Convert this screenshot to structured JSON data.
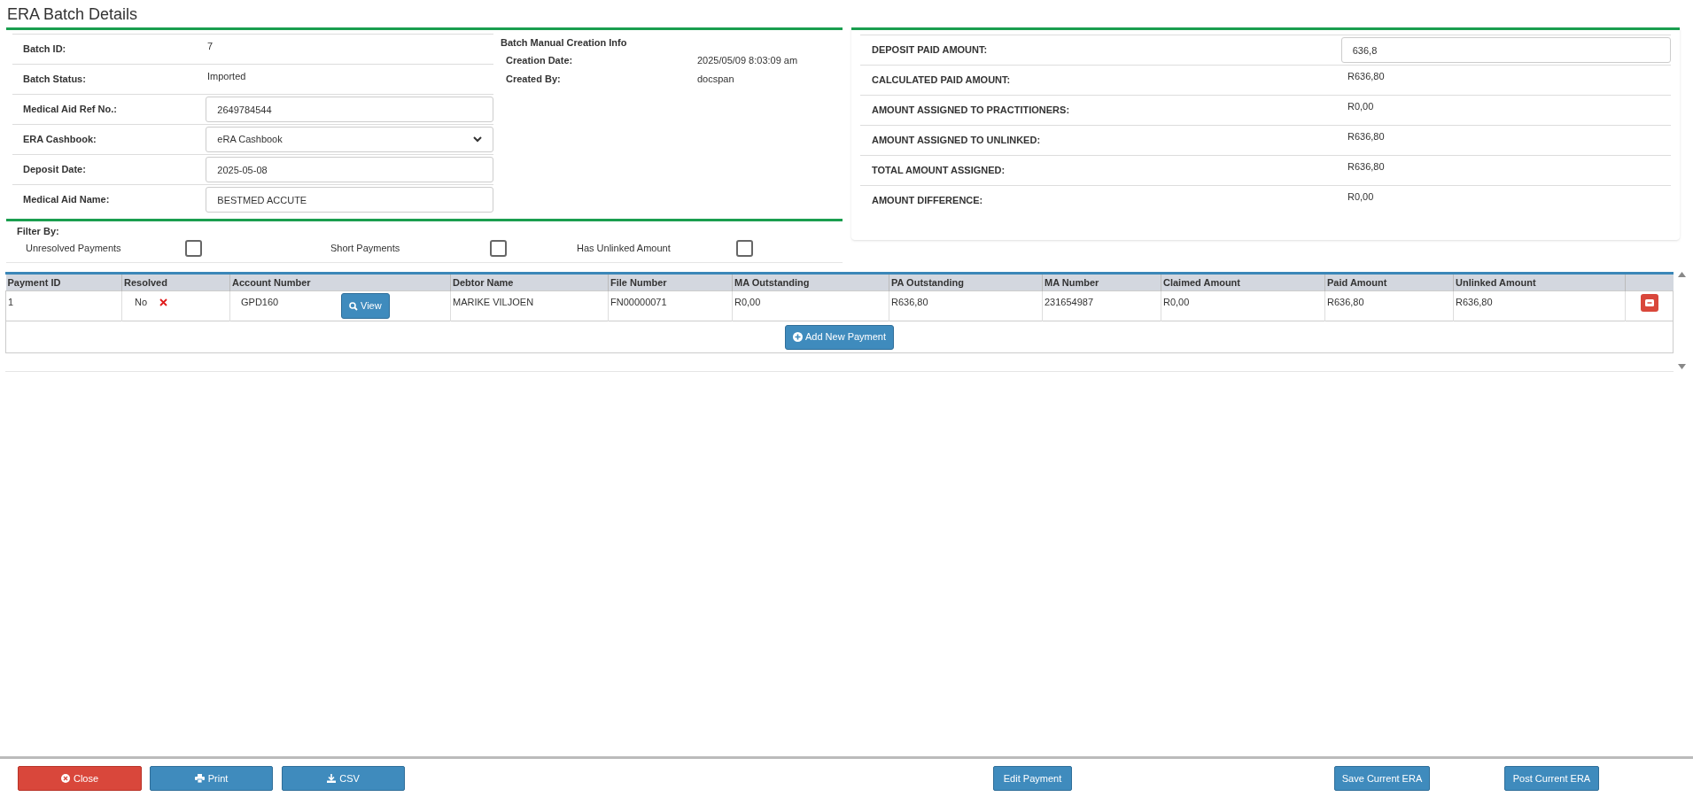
{
  "title": "ERA Batch Details",
  "batch_fields": [
    {
      "label": "Batch ID:",
      "kind": "text",
      "value": "7"
    },
    {
      "label": "Batch Status:",
      "kind": "text",
      "value": "Imported"
    },
    {
      "label": "Medical Aid Ref No.:",
      "kind": "input",
      "value": "2649784544"
    },
    {
      "label": "ERA Cashbook:",
      "kind": "select",
      "value": "eRA Cashbook"
    },
    {
      "label": "Deposit Date:",
      "kind": "input",
      "value": "2025-05-08"
    },
    {
      "label": "Medical Aid Name:",
      "kind": "input",
      "value": "BESTMED ACCUTE"
    }
  ],
  "creation_info": {
    "heading": "Batch Manual Creation Info",
    "rows": [
      {
        "label": "Creation Date:",
        "value": "2025/05/09 8:03:09 am"
      },
      {
        "label": "Created By:",
        "value": "docspan"
      }
    ]
  },
  "filter": {
    "heading": "Filter By:",
    "options": [
      {
        "label": "Unresolved Payments",
        "checked": false
      },
      {
        "label": "Short Payments",
        "checked": false
      },
      {
        "label": "Has Unlinked Amount",
        "checked": false
      }
    ]
  },
  "amounts": [
    {
      "label": "DEPOSIT PAID AMOUNT:",
      "kind": "input",
      "value": "636,8"
    },
    {
      "label": "CALCULATED PAID AMOUNT:",
      "kind": "text",
      "value": "R636,80"
    },
    {
      "label": "AMOUNT ASSIGNED TO PRACTITIONERS:",
      "kind": "text",
      "value": "R0,00"
    },
    {
      "label": "AMOUNT ASSIGNED TO UNLINKED:",
      "kind": "text",
      "value": "R636,80"
    },
    {
      "label": "TOTAL AMOUNT ASSIGNED:",
      "kind": "text",
      "value": "R636,80"
    },
    {
      "label": "AMOUNT DIFFERENCE:",
      "kind": "text",
      "value": "R0,00"
    }
  ],
  "table": {
    "columns": [
      "Payment ID",
      "Resolved",
      "Account Number",
      "Debtor Name",
      "File Number",
      "MA Outstanding",
      "PA Outstanding",
      "MA Number",
      "Claimed Amount",
      "Paid Amount",
      "Unlinked Amount"
    ],
    "rows": [
      {
        "payment_id": "1",
        "resolved_text": "No",
        "resolved": false,
        "account_number": "GPD160",
        "view_button": "View",
        "debtor_name": "MARIKE VILJOEN",
        "file_number": "FN00000071",
        "ma_outstanding": "R0,00",
        "pa_outstanding": "R636,80",
        "ma_number": "231654987",
        "claimed_amount": "R0,00",
        "paid_amount": "R636,80",
        "unlinked_amount": "R636,80"
      }
    ],
    "add_button": "Add New Payment"
  },
  "footer_buttons": [
    {
      "label": "Close",
      "kind": "close"
    },
    {
      "label": "Print",
      "kind": "print"
    },
    {
      "label": "CSV",
      "kind": "csv"
    },
    {
      "label": "Edit Payment",
      "kind": "plain"
    },
    {
      "label": "Save Current ERA",
      "kind": "plain"
    },
    {
      "label": "Post Current ERA",
      "kind": "plain"
    }
  ]
}
